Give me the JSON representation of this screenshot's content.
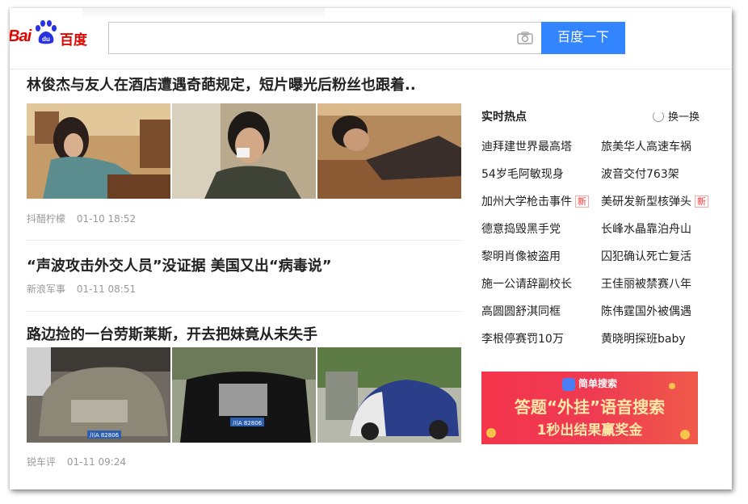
{
  "header": {
    "logo_latin": "Bai",
    "logo_cn": "百度",
    "search": {
      "value": "",
      "placeholder": ""
    },
    "search_button": "百度一下"
  },
  "feed": {
    "items": [
      {
        "title": "林俊杰与友人在酒店遭遇奇葩规定，短片曝光后粉丝也跟着..",
        "source": "抖醋柠檬",
        "time": "01-10 18:52"
      },
      {
        "title": "“声波攻击外交人员”没证据 美国又出“病毒说”",
        "source": "新浪军事",
        "time": "01-11 08:51"
      },
      {
        "title": "路边捡的一台劳斯莱斯，开去把妹竟从未失手",
        "source": "锐车评",
        "time": "01-11 09:24"
      }
    ],
    "plate_text": "川A 82806"
  },
  "hot": {
    "title": "实时热点",
    "refresh": "换一换",
    "new_label": "新",
    "items": [
      {
        "text": "迪拜建世界最高塔",
        "new": false
      },
      {
        "text": "旅美华人高速车祸",
        "new": false
      },
      {
        "text": "54岁毛阿敏现身",
        "new": false
      },
      {
        "text": "波音交付763架",
        "new": false
      },
      {
        "text": "加州大学枪击事件",
        "new": true
      },
      {
        "text": "美研发新型核弹头",
        "new": true
      },
      {
        "text": "德意捣毁黑手党",
        "new": false
      },
      {
        "text": "长峰水晶靠泊舟山",
        "new": false
      },
      {
        "text": "黎明肖像被盗用",
        "new": false
      },
      {
        "text": "囚犯确认死亡复活",
        "new": false
      },
      {
        "text": "施一公请辞副校长",
        "new": false
      },
      {
        "text": "王佳丽被禁赛八年",
        "new": false
      },
      {
        "text": "高圆圆舒淇同框",
        "new": false
      },
      {
        "text": "陈伟霆国外被偶遇",
        "new": false
      },
      {
        "text": "李根停赛罚10万",
        "new": false
      },
      {
        "text": "黄晓明探班baby",
        "new": false
      }
    ]
  },
  "ad": {
    "brand": "简单搜索",
    "line1": "答题“外挂”语音搜索",
    "line2": "1秒出结果赢奖金"
  },
  "colors": {
    "brand_red": "#e10601",
    "brand_blue": "#3385ff",
    "meta_gray": "#999999",
    "new_tag": "#ff3333"
  }
}
